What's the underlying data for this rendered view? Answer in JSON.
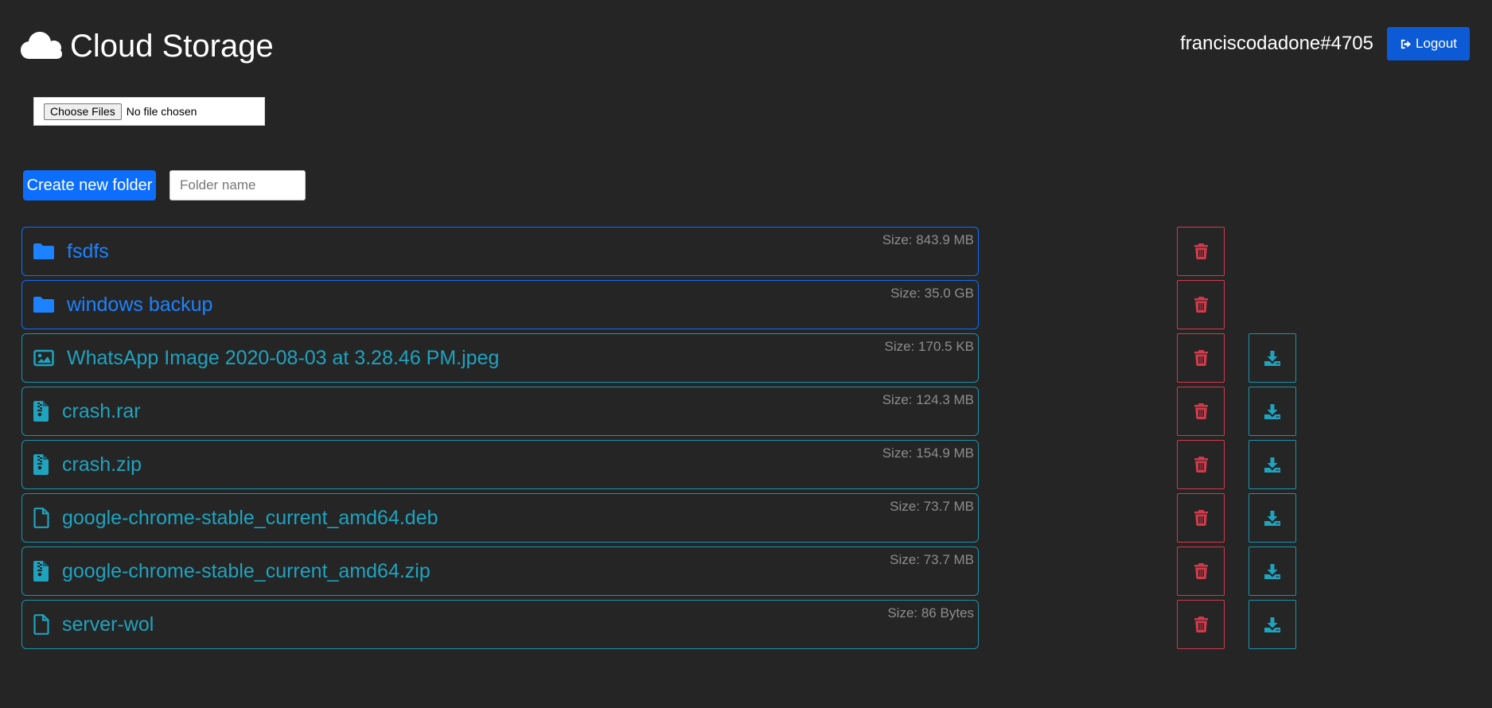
{
  "header": {
    "title": "Cloud Storage",
    "username": "franciscodadone#4705",
    "logout_label": "Logout"
  },
  "upload": {
    "button_label": "Choose Files",
    "status_text": "No file chosen"
  },
  "folder_form": {
    "create_label": "Create new folder",
    "placeholder": "Folder name"
  },
  "files": [
    {
      "name": "fsdfs",
      "size": "Size: 843.9 MB",
      "icon": "folder-icon"
    },
    {
      "name": "windows backup",
      "size": "Size: 35.0 GB",
      "icon": "folder-icon"
    },
    {
      "name": "WhatsApp Image 2020-08-03 at 3.28.46 PM.jpeg",
      "size": "Size: 170.5 KB",
      "icon": "image-icon"
    },
    {
      "name": "crash.rar",
      "size": "Size: 124.3 MB",
      "icon": "archive-file-icon"
    },
    {
      "name": "crash.zip",
      "size": "Size: 154.9 MB",
      "icon": "archive-file-icon"
    },
    {
      "name": "google-chrome-stable_current_amd64.deb",
      "size": "Size: 73.7 MB",
      "icon": "file-icon"
    },
    {
      "name": "google-chrome-stable_current_amd64.zip",
      "size": "Size: 73.7 MB",
      "icon": "archive-file-icon"
    },
    {
      "name": "server-wol",
      "size": "Size: 86 Bytes",
      "icon": "file-icon"
    }
  ],
  "colors": {
    "background": "#252525",
    "primary": "#0d6efd",
    "info": "#1fa3bf",
    "danger": "#d23a4c",
    "muted": "#8d8d8d"
  }
}
